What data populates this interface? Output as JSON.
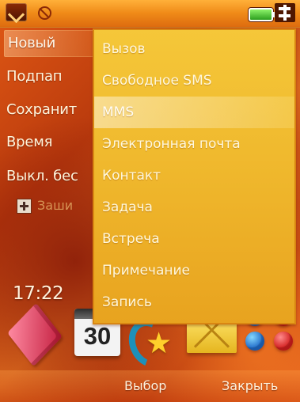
{
  "status_bar": {
    "icons": [
      "menu-key-icon",
      "silent-icon",
      "battery-icon",
      "signal-icon"
    ],
    "battery_color": "#2c9e1e"
  },
  "left_menu": {
    "items": [
      {
        "label": "Новый",
        "selected": true
      },
      {
        "label": "Подпап"
      },
      {
        "label": "Сохранит"
      },
      {
        "label": "Время"
      },
      {
        "label": "Выкл. бес"
      }
    ]
  },
  "shortcut": {
    "label": "Заши"
  },
  "clock": {
    "time": "17:22"
  },
  "dropdown_menu": {
    "items": [
      {
        "label": "Вызов"
      },
      {
        "label": "Свободное SMS"
      },
      {
        "label": "MMS",
        "highlighted": true
      },
      {
        "label": "Электронная почта"
      },
      {
        "label": "Контакт"
      },
      {
        "label": "Задача"
      },
      {
        "label": "Встреча"
      },
      {
        "label": "Примечание"
      },
      {
        "label": "Запись"
      }
    ],
    "background": "#efb72c"
  },
  "dock": {
    "icons": [
      "book-icon",
      "calendar-icon",
      "phone-star-icon",
      "mail-icon",
      "apps-dots-icon"
    ],
    "calendar_day": "30"
  },
  "softkeys": {
    "select": "Выбор",
    "close": "Закрыть"
  }
}
